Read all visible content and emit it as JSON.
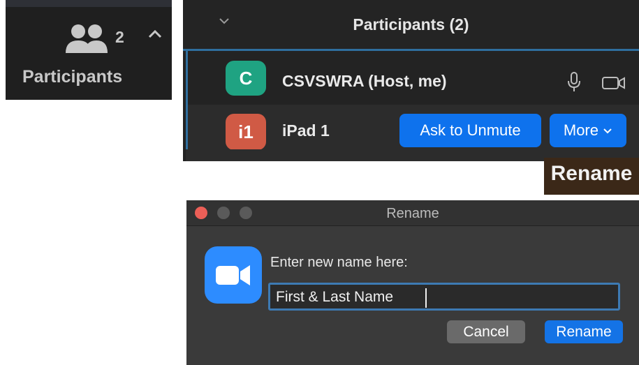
{
  "toolbar": {
    "participant_count": "2",
    "label": "Participants"
  },
  "panel": {
    "title": "Participants (2)",
    "participants": [
      {
        "initials": "C",
        "name": "CSVSWRA (Host, me)",
        "avatar_color": "#1fa382"
      },
      {
        "initials": "i1",
        "name": "iPad 1",
        "avatar_color": "#d05a45"
      }
    ],
    "ask_to_unmute_label": "Ask to Unmute",
    "more_label": "More"
  },
  "menu": {
    "rename_label": "Rename"
  },
  "dialog": {
    "title": "Rename",
    "prompt": "Enter new name here:",
    "input_value": "First & Last Name",
    "cancel_label": "Cancel",
    "rename_label": "Rename"
  },
  "colors": {
    "accent": "#0e72ed",
    "zoom_icon": "#2d8cff"
  }
}
